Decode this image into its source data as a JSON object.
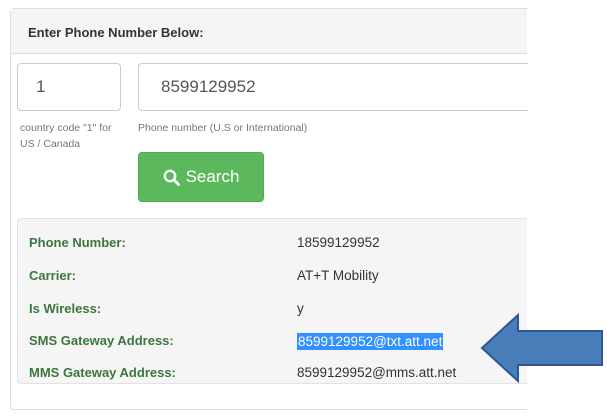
{
  "panel": {
    "title": "Enter Phone Number Below:"
  },
  "form": {
    "country_code_value": "1",
    "country_code_help": "country code \"1\" for US / Canada",
    "phone_value": "8599129952",
    "phone_help": "Phone number (U.S or International)",
    "search_label": "Search",
    "search_icon": "search-icon",
    "button_color": "#5cb85c"
  },
  "results": {
    "rows": [
      {
        "label": "Phone Number:",
        "value": "18599129952",
        "highlighted": false
      },
      {
        "label": "Carrier:",
        "value": "AT+T Mobility",
        "highlighted": false
      },
      {
        "label": "Is Wireless:",
        "value": "y",
        "highlighted": false
      },
      {
        "label": "SMS Gateway Address:",
        "value": "8599129952@txt.att.net",
        "highlighted": true
      },
      {
        "label": "MMS Gateway Address:",
        "value": "8599129952@mms.att.net",
        "highlighted": false
      }
    ],
    "label_color": "#3c763d",
    "selection_color": "#3390ff"
  },
  "annotation": {
    "arrow_icon": "left-arrow-icon",
    "arrow_color": "#4a7ebb"
  }
}
